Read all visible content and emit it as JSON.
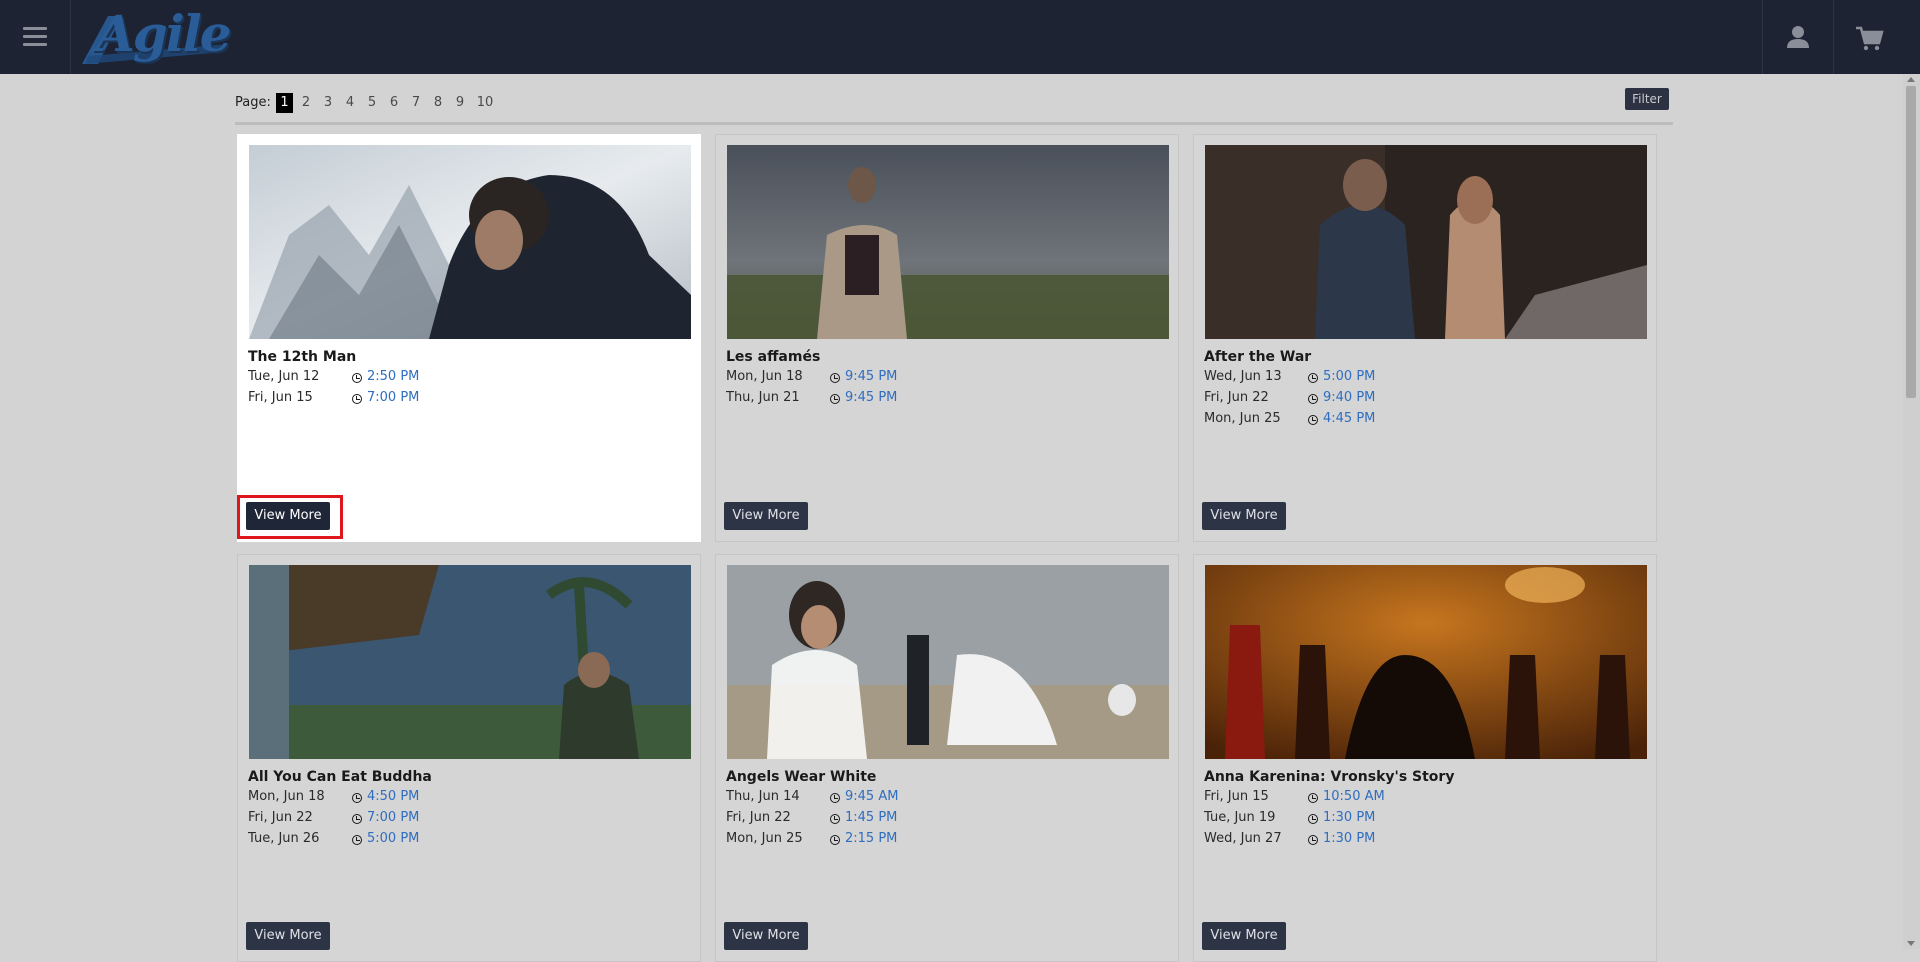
{
  "header": {
    "logo_text": "Agile",
    "colors": {
      "bar": "#1d2333",
      "logo": "#2a5d98"
    },
    "icons": [
      "hamburger-menu-icon",
      "user-icon",
      "shopping-cart-icon"
    ]
  },
  "pagination": {
    "label": "Page:",
    "pages": [
      "1",
      "2",
      "3",
      "4",
      "5",
      "6",
      "7",
      "8",
      "9",
      "10"
    ],
    "current": "1"
  },
  "filter_label": "Filter",
  "view_more_label": "View More",
  "films": [
    {
      "title": "The 12th Man",
      "showtimes": [
        {
          "date": "Tue, Jun 12",
          "time": "2:50 PM"
        },
        {
          "date": "Fri, Jun 15",
          "time": "7:00 PM"
        }
      ]
    },
    {
      "title": "Les affamés",
      "showtimes": [
        {
          "date": "Mon, Jun 18",
          "time": "9:45 PM"
        },
        {
          "date": "Thu, Jun 21",
          "time": "9:45 PM"
        }
      ]
    },
    {
      "title": "After the War",
      "showtimes": [
        {
          "date": "Wed, Jun 13",
          "time": "5:00 PM"
        },
        {
          "date": "Fri, Jun 22",
          "time": "9:40 PM"
        },
        {
          "date": "Mon, Jun 25",
          "time": "4:45 PM"
        }
      ]
    },
    {
      "title": "All You Can Eat Buddha",
      "showtimes": [
        {
          "date": "Mon, Jun 18",
          "time": "4:50 PM"
        },
        {
          "date": "Fri, Jun 22",
          "time": "7:00 PM"
        },
        {
          "date": "Tue, Jun 26",
          "time": "5:00 PM"
        }
      ]
    },
    {
      "title": "Angels Wear White",
      "showtimes": [
        {
          "date": "Thu, Jun 14",
          "time": "9:45 AM"
        },
        {
          "date": "Fri, Jun 22",
          "time": "1:45 PM"
        },
        {
          "date": "Mon, Jun 25",
          "time": "2:15 PM"
        }
      ]
    },
    {
      "title": "Anna Karenina: Vronsky's Story",
      "showtimes": [
        {
          "date": "Fri, Jun 15",
          "time": "10:50 AM"
        },
        {
          "date": "Tue, Jun 19",
          "time": "1:30 PM"
        },
        {
          "date": "Wed, Jun 27",
          "time": "1:30 PM"
        }
      ]
    }
  ],
  "accent_colors": {
    "link": "#2f6dbf",
    "button": "#2c3446",
    "highlight": "#e0161e"
  }
}
